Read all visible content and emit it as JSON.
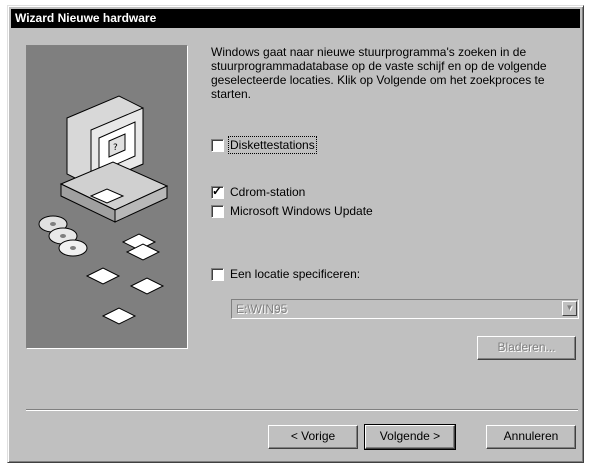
{
  "dialog": {
    "title": "Wizard Nieuwe hardware"
  },
  "description": "Windows gaat naar nieuwe stuurprogramma's zoeken in de stuurprogrammadatabase op de vaste schijf en op de volgende geselecteerde locaties. Klik op Volgende om het zoekproces te starten.",
  "options": {
    "floppy": {
      "label": "Diskettestations",
      "checked": false
    },
    "cdrom": {
      "label": "Cdrom-station",
      "checked": true
    },
    "windows_update": {
      "label": "Microsoft Windows Update",
      "checked": false
    },
    "location": {
      "label": "Een locatie specificeren:",
      "checked": false
    }
  },
  "location_combo": {
    "value": "E:\\WIN95"
  },
  "buttons": {
    "browse": "Bladeren...",
    "back": "< Vorige",
    "next": "Volgende >",
    "cancel": "Annuleren"
  },
  "colors": {
    "face": "#c0c0c0",
    "titlebar": "#000000",
    "graphic_bg": "#7f7f7f"
  }
}
